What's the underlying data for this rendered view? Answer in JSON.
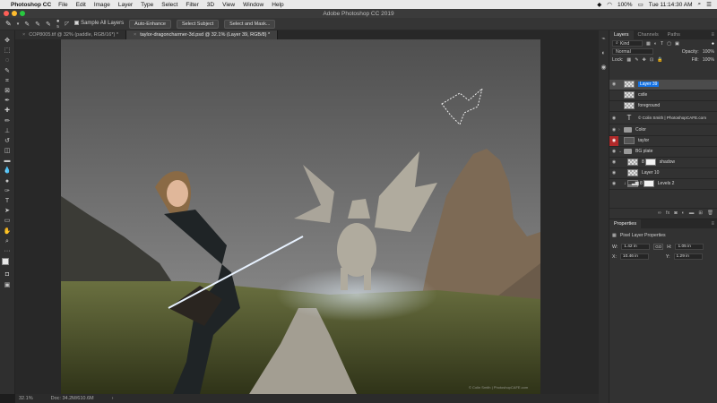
{
  "menubar": {
    "apple": "",
    "app_name": "Photoshop CC",
    "items": [
      "File",
      "Edit",
      "Image",
      "Layer",
      "Type",
      "Select",
      "Filter",
      "3D",
      "View",
      "Window",
      "Help"
    ],
    "battery": "100%",
    "clock": "Tue 11:14:30 AM"
  },
  "titlebar": {
    "title": "Adobe Photoshop CC 2019"
  },
  "options": {
    "sample_all_layers": "Sample All Layers",
    "auto_enhance": "Auto-Enhance",
    "select_subject": "Select Subject",
    "select_and_mask": "Select and Mask...",
    "brush_size": "5"
  },
  "tabs": [
    {
      "label": "COP8005.tif @ 32% (paddle, RGB/16*) *"
    },
    {
      "label": "taylor-dragoncharmer-3d.psd @ 32.1% (Layer 39, RGB/8) *"
    }
  ],
  "status": {
    "zoom": "32.1%",
    "doc": "Doc: 34.2M/610.6M"
  },
  "layers_panel": {
    "tabs": [
      "Layers",
      "Channels",
      "Paths"
    ],
    "kind": "Kind",
    "blend_mode": "Normal",
    "opacity_label": "Opacity:",
    "opacity_value": "100%",
    "lock_label": "Lock:",
    "fill_label": "Fill:",
    "fill_value": "100%",
    "layers": [
      {
        "name": "Layer 39",
        "type": "pixel",
        "selected": true,
        "visible": true
      },
      {
        "name": "cstle",
        "type": "pixel",
        "visible": false
      },
      {
        "name": "foreground",
        "type": "pixel",
        "visible": false
      },
      {
        "name": "© Colin Smith | PhotoshopCAFE.com",
        "type": "text",
        "visible": true
      },
      {
        "name": "Color",
        "type": "group",
        "visible": true
      },
      {
        "name": "taylor",
        "type": "pixel",
        "visible": true,
        "red_eye": true
      },
      {
        "name": "BG plate",
        "type": "group",
        "visible": true
      },
      {
        "name": "shadow",
        "type": "masked",
        "visible": true
      },
      {
        "name": "Layer 10",
        "type": "pixel",
        "visible": true
      },
      {
        "name": "Levels 2",
        "type": "adjustment",
        "visible": true
      }
    ]
  },
  "properties_panel": {
    "title": "Properties",
    "subtitle": "Pixel Layer Properties",
    "w_label": "W:",
    "w_value": "1.42 in",
    "h_label": "H:",
    "h_value": "1.05 in",
    "x_label": "X:",
    "x_value": "10.46 in",
    "y_label": "Y:",
    "y_value": "1.29 in",
    "link_label": "GO"
  },
  "artwork": {
    "watermark": "© Colin Smith | PhotoshopCAFE.com"
  },
  "colors": {
    "accent": "#1473e6",
    "panel": "#323232",
    "selected_layer": "#4b4b4b"
  }
}
